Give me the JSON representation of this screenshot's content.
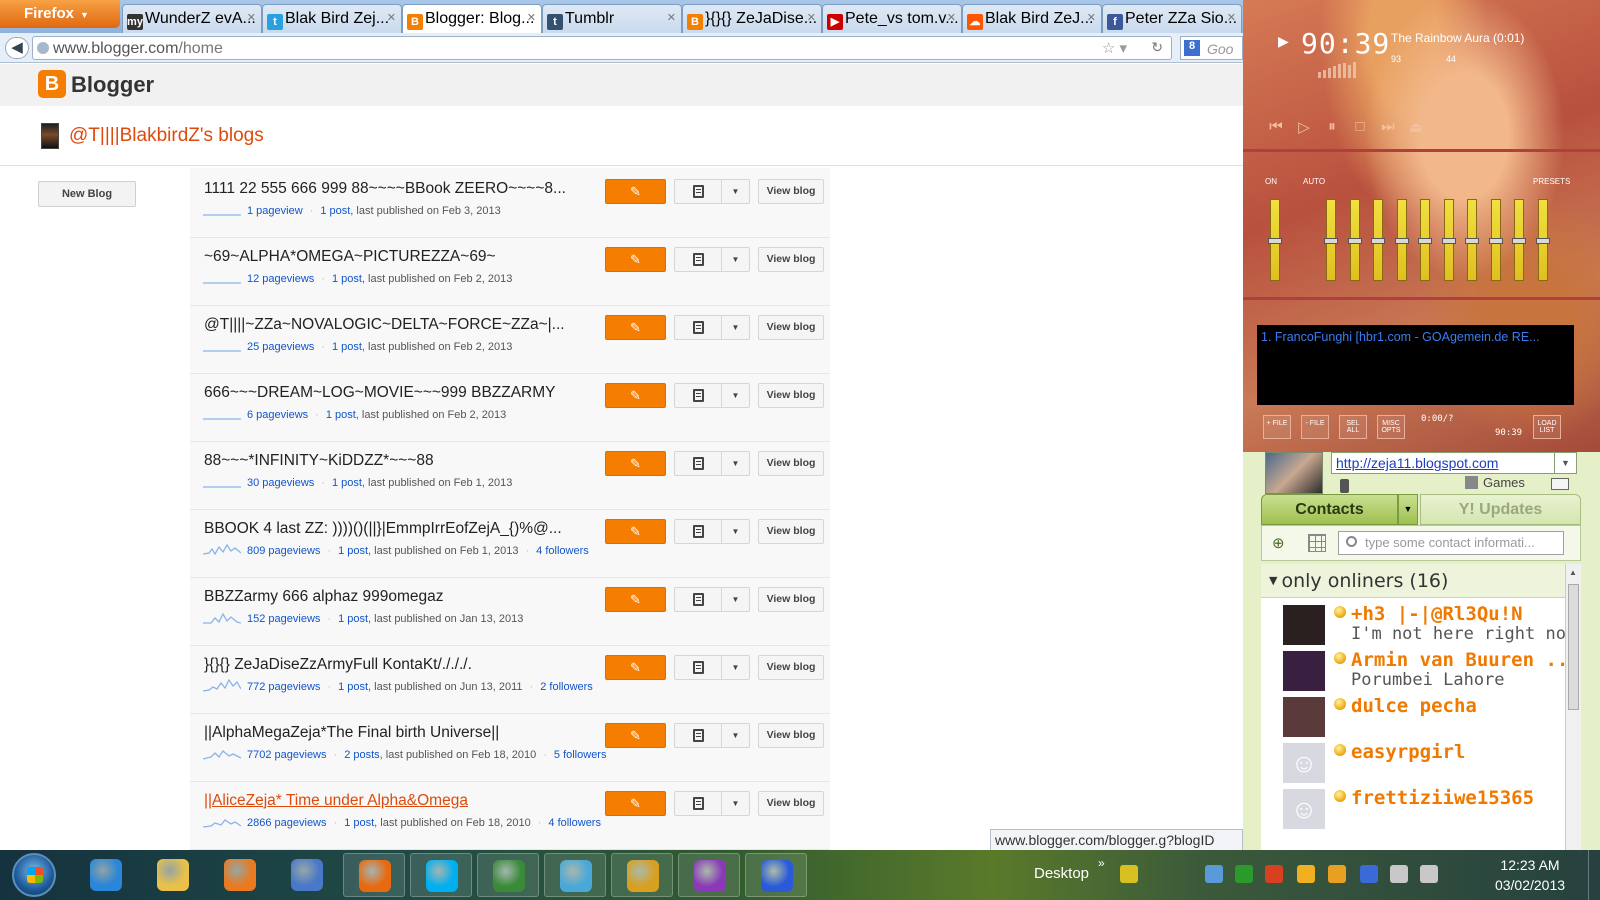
{
  "browser": {
    "menu_label": "Firefox",
    "tabs": [
      {
        "label": "WunderZ evA...",
        "favicon": "myspace-icon",
        "color": "#333333",
        "glyph": "my"
      },
      {
        "label": "Blak Bird Zej...",
        "favicon": "twitter-icon",
        "color": "#2aa0e0",
        "glyph": "t"
      },
      {
        "label": "Blogger: Blog...",
        "favicon": "blogger-icon",
        "color": "#f57d00",
        "glyph": "B"
      },
      {
        "label": "Tumblr",
        "favicon": "tumblr-icon",
        "color": "#34526f",
        "glyph": "t"
      },
      {
        "label": "}{}{} ZeJaDise...",
        "favicon": "blogger-icon",
        "color": "#f57d00",
        "glyph": "B"
      },
      {
        "label": "Pete_vs tom.v...",
        "favicon": "youtube-icon",
        "color": "#cc0000",
        "glyph": "▶"
      },
      {
        "label": "Blak Bird ZeJ...",
        "favicon": "soundcloud-icon",
        "color": "#ff5500",
        "glyph": "☁"
      },
      {
        "label": "Peter ZZa Sio...",
        "favicon": "facebook-icon",
        "color": "#3b5998",
        "glyph": "f"
      }
    ],
    "url_host": "www.blogger.com",
    "url_path": "/home",
    "search_placeholder": "Goo"
  },
  "blogger": {
    "app_name": "Blogger",
    "user_title": "@T||||BlakbirdZ's blogs",
    "new_blog_label": "New Blog",
    "view_blog_label": "View blog",
    "blogs": [
      {
        "title": "1111 22 555 666 999 88~~~~BBook ZEERO~~~~8...",
        "pageviews": "1 pageview",
        "posts": "1 post",
        "published": ", last published on Feb 3, 2013",
        "followers": ""
      },
      {
        "title": "~69~ALPHA*OMEGA~PICTUREZZA~69~",
        "pageviews": "12 pageviews",
        "posts": "1 post",
        "published": ", last published on Feb 2, 2013",
        "followers": ""
      },
      {
        "title": "@T||||~ZZa~NOVALOGIC~DELTA~FORCE~ZZa~|...",
        "pageviews": "25 pageviews",
        "posts": "1 post",
        "published": ", last published on Feb 2, 2013",
        "followers": ""
      },
      {
        "title": "666~~~DREAM~LOG~MOVIE~~~999 BBZZARMY",
        "pageviews": "6 pageviews",
        "posts": "1 post",
        "published": ", last published on Feb 2, 2013",
        "followers": ""
      },
      {
        "title": "88~~~*INFINITY~KiDDZZ*~~~88",
        "pageviews": "30 pageviews",
        "posts": "1 post",
        "published": ", last published on Feb 1, 2013",
        "followers": ""
      },
      {
        "title": "BBOOK 4 last ZZ: ))))()(||}|EmmpIrrEofZejA_{)%@...",
        "pageviews": "809 pageviews",
        "posts": "1 post",
        "published": ", last published on Feb 1, 2013",
        "followers": "4 followers"
      },
      {
        "title": "BBZZarmy 666 alphaz 999omegaz",
        "pageviews": "152 pageviews",
        "posts": "1 post",
        "published": ", last published on Jan 13, 2013",
        "followers": ""
      },
      {
        "title": "}{}{} ZeJaDiseZzArmyFull KontaKt/./././.",
        "pageviews": "772 pageviews",
        "posts": "1 post",
        "published": ", last published on Jun 13, 2011",
        "followers": "2 followers"
      },
      {
        "title": "||AlphaMegaZeja*The Final birth Universe||",
        "pageviews": "7702 pageviews",
        "posts": "2 posts",
        "published": ", last published on Feb 18, 2010",
        "followers": "5 followers"
      },
      {
        "title": "||AliceZeja* Time under Alpha&Omega",
        "pageviews": "2866 pageviews",
        "posts": "1 post",
        "published": ", last published on Feb 18, 2010",
        "followers": "4 followers"
      }
    ],
    "status_url": "www.blogger.com/blogger.g?blogID"
  },
  "winamp": {
    "time": "90:39",
    "track": "The Rainbow Aura (0:01)",
    "kbps": "93",
    "khz": "44",
    "eq_on": "ON",
    "eq_auto": "AUTO",
    "eq_presets": "PRESETS",
    "eq_levels": [
      0.5,
      0.5,
      0.5,
      0.5,
      0.5,
      0.5,
      0.5,
      0.5,
      0.5,
      0.5,
      0.5
    ],
    "playlist_item": "1. FrancoFunghi [hbr1.com - GOAgemein.de RE...",
    "playlist_buttons": [
      "+ FILE",
      "- FILE",
      "SEL ALL",
      "MISC OPTS",
      "LOAD LIST"
    ],
    "playlist_elapsed": "0:00/?",
    "playlist_total": "90:39"
  },
  "messenger": {
    "status_url": "http://zeja11.blogspot.com",
    "games_label": "Games",
    "tab_contacts": "Contacts",
    "tab_updates": "Y! Updates",
    "search_placeholder": "type some contact informati...",
    "group_label": "only onliners (16)",
    "contacts": [
      {
        "name": "+h3 |-|@Rl3Qu!N",
        "message": "I'm not here right now",
        "pic": "#2a2020"
      },
      {
        "name": "Armin van Buuren ...",
        "message": "Porumbei Lahore",
        "pic": "#3a2040"
      },
      {
        "name": "dulce pecha",
        "message": "",
        "pic": "#5a3a3a"
      },
      {
        "name": "easyrpgirl",
        "message": "",
        "pic": "#d8d8e0"
      },
      {
        "name": "frettiziiwe15365",
        "message": "",
        "pic": "#d8d8e0"
      }
    ]
  },
  "taskbar": {
    "apps": [
      {
        "name": "internet-explorer-icon",
        "color": "#2a86d8",
        "open": false
      },
      {
        "name": "file-explorer-icon",
        "color": "#e8c04a",
        "open": false
      },
      {
        "name": "media-player-icon",
        "color": "#e87a20",
        "open": false
      },
      {
        "name": "paint-icon",
        "color": "#4a78c8",
        "open": false
      },
      {
        "name": "firefox-icon",
        "color": "#e86a10",
        "open": true
      },
      {
        "name": "skype-icon",
        "color": "#00aff0",
        "open": true
      },
      {
        "name": "task-manager-icon",
        "color": "#3a8a3a",
        "open": true
      },
      {
        "name": "messenger-icon",
        "color": "#4aa8d8",
        "open": true
      },
      {
        "name": "winamp-icon",
        "color": "#d8a020",
        "open": true
      },
      {
        "name": "yahoo-messenger-icon",
        "color": "#8a3ab8",
        "open": true
      },
      {
        "name": "bird-icon",
        "color": "#2a5ad8",
        "open": true
      }
    ],
    "desktop_label": "Desktop",
    "time": "12:23 AM",
    "date": "03/02/2013",
    "tray": [
      "#d8c020",
      "#5a9ad8",
      "#2a9a2a",
      "#d84020",
      "#f0b020",
      "#e8a020",
      "#3a6ad8",
      "#c8c8c8",
      "#c8c8c8"
    ]
  }
}
